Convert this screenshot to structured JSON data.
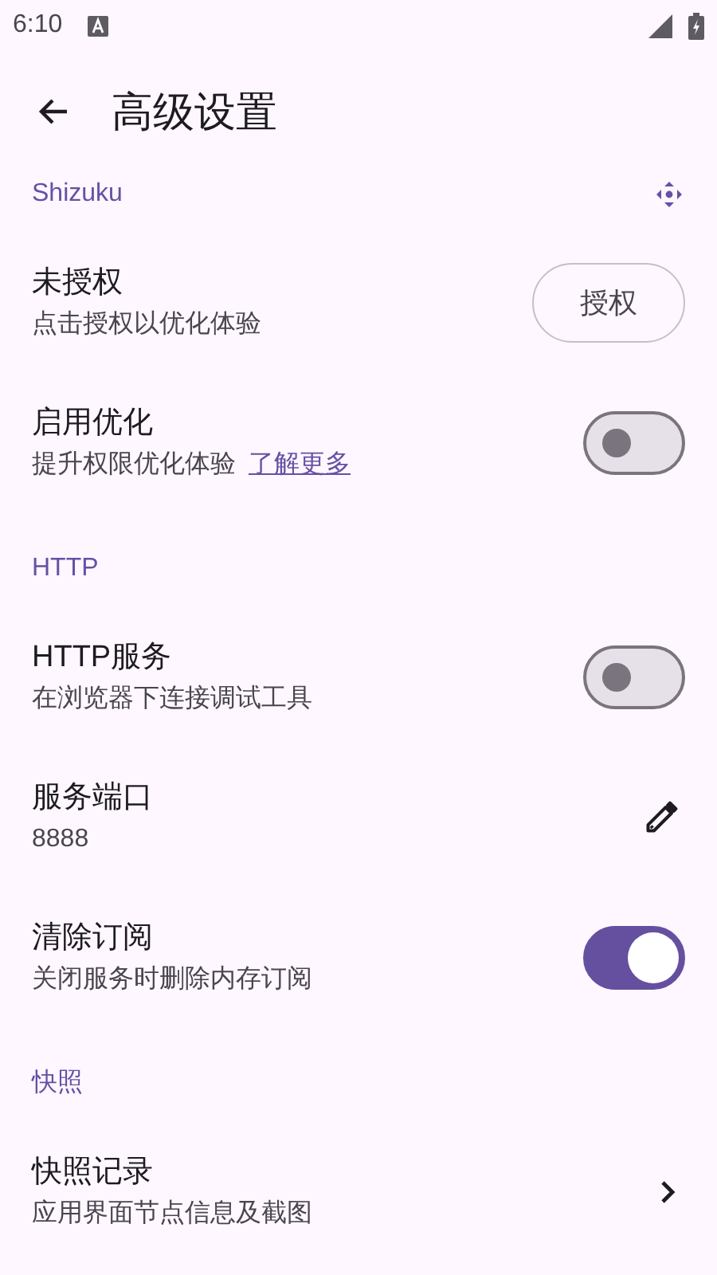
{
  "status_bar": {
    "time": "6:10"
  },
  "app_bar": {
    "title": "高级设置"
  },
  "sections": [
    {
      "title": "Shizuku",
      "icon": true,
      "items": [
        {
          "kind": "button",
          "title": "未授权",
          "subtitle": "点击授权以优化体验",
          "button": "授权"
        },
        {
          "kind": "switch",
          "title": "启用优化",
          "subtitle": "提升权限优化体验",
          "link": "了解更多",
          "on": false
        }
      ]
    },
    {
      "title": "HTTP",
      "icon": false,
      "items": [
        {
          "kind": "switch",
          "title": "HTTP服务",
          "subtitle": "在浏览器下连接调试工具",
          "on": false
        },
        {
          "kind": "edit",
          "title": "服务端口",
          "subtitle": "8888"
        },
        {
          "kind": "switch",
          "title": "清除订阅",
          "subtitle": "关闭服务时删除内存订阅",
          "on": true
        }
      ]
    },
    {
      "title": "快照",
      "icon": false,
      "items": [
        {
          "kind": "chevron",
          "title": "快照记录",
          "subtitle": "应用界面节点信息及截图"
        }
      ]
    }
  ]
}
